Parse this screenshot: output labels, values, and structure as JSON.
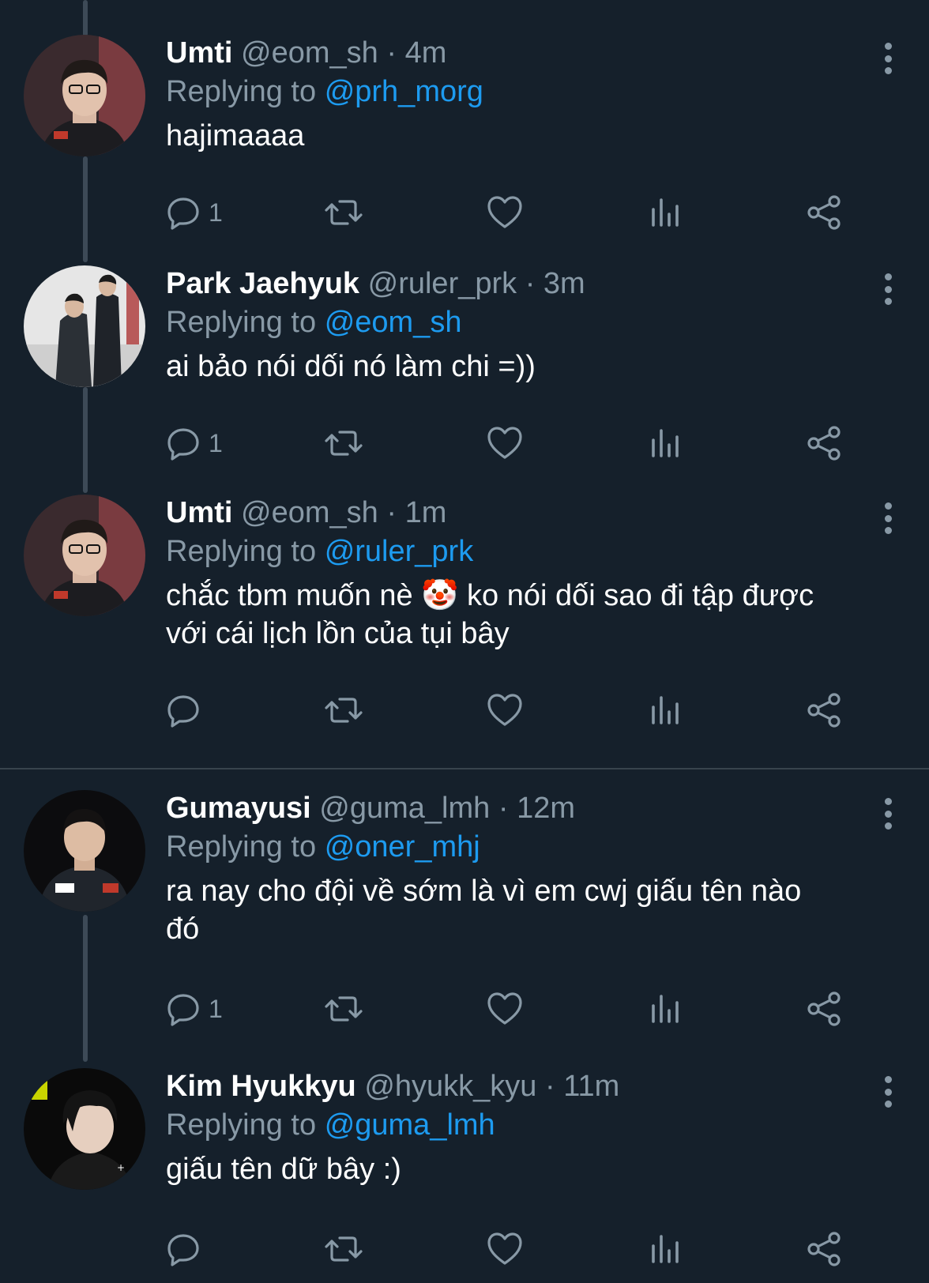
{
  "colors": {
    "background": "#15202b",
    "text_primary": "#ffffff",
    "text_secondary": "#8899a6",
    "mention": "#1d9bf0",
    "thread_line": "#3d4a57",
    "separator": "#38444d"
  },
  "tweets": [
    {
      "name": "Umti",
      "handle": "@eom_sh",
      "time": "4m",
      "dot": "·",
      "replying_prefix": "Replying to",
      "replying_to": "@prh_morg",
      "text_lines": [
        "hajimaaaa"
      ],
      "reply_count": "1",
      "icons": [
        "reply-icon",
        "retweet-icon",
        "like-icon",
        "analytics-icon",
        "share-icon",
        "more-icon"
      ]
    },
    {
      "name": "Park Jaehyuk",
      "handle": "@ruler_prk",
      "time": "3m",
      "dot": "·",
      "replying_prefix": "Replying to",
      "replying_to": "@eom_sh",
      "text_lines": [
        "ai bảo nói dối nó làm chi =))"
      ],
      "reply_count": "1",
      "icons": [
        "reply-icon",
        "retweet-icon",
        "like-icon",
        "analytics-icon",
        "share-icon",
        "more-icon"
      ]
    },
    {
      "name": "Umti",
      "handle": "@eom_sh",
      "time": "1m",
      "dot": "·",
      "replying_prefix": "Replying to",
      "replying_to": "@ruler_prk",
      "text_lines": [
        "chắc tbm muốn nè 🤡 ko nói dối sao đi tập được",
        "với cái lịch lồn của tụi bây"
      ],
      "reply_count": "",
      "icons": [
        "reply-icon",
        "retweet-icon",
        "like-icon",
        "analytics-icon",
        "share-icon",
        "more-icon"
      ]
    },
    {
      "name": "Gumayusi",
      "handle": "@guma_lmh",
      "time": "12m",
      "dot": "·",
      "replying_prefix": "Replying to",
      "replying_to": "@oner_mhj",
      "text_lines": [
        "ra nay cho đội về sớm là vì em cwj giấu tên nào",
        "đó"
      ],
      "reply_count": "1",
      "icons": [
        "reply-icon",
        "retweet-icon",
        "like-icon",
        "analytics-icon",
        "share-icon",
        "more-icon"
      ]
    },
    {
      "name": "Kim Hyukkyu",
      "handle": "@hyukk_kyu",
      "time": "11m",
      "dot": "·",
      "replying_prefix": "Replying to",
      "replying_to": "@guma_lmh",
      "text_lines": [
        "giấu tên dữ bây :)"
      ],
      "reply_count": "",
      "icons": [
        "reply-icon",
        "retweet-icon",
        "like-icon",
        "analytics-icon",
        "share-icon",
        "more-icon"
      ]
    }
  ]
}
